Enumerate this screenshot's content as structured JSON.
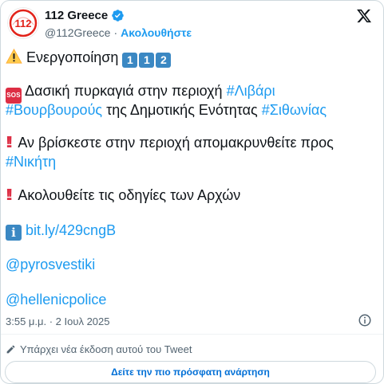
{
  "header": {
    "display_name": "112 Greece",
    "handle": "@112Greece",
    "separator": "·",
    "follow_label": "Ακολουθήστε",
    "avatar_text": "112"
  },
  "tweet": {
    "line1_text": "Ενεργοποίηση",
    "keycaps": [
      "1",
      "1",
      "2"
    ],
    "sos_badge": "SOS",
    "line2_text": "Δασική πυρκαγιά στην περιοχή",
    "line2_tag": "#Λιβάρι",
    "line3_tag1": "#Βουρβουρούς",
    "line3_text": "της Δημοτικής Ενότητας",
    "line3_tag2": "#Σιθωνίας",
    "line4_text": "Αν βρίσκεστε στην περιοχή απομακρυνθείτε προς",
    "line5_tag": "#Νικήτη",
    "line6_text": "Ακολουθείτε τις οδηγίες των Αρχών",
    "info_glyph": "i",
    "link": "bit.ly/429cngB",
    "mention1": "@pyrosvestiki",
    "mention2": "@hellenicpolice"
  },
  "meta": {
    "timestamp": "3:55 μ.μ. · 2 Ιουλ 2025",
    "edit_notice": "Υπάρχει νέα έκδοση αυτού του Tweet",
    "latest_button": "Δείτε την πιο πρόσφατη ανάρτηση"
  },
  "icons": [
    "verified-badge-icon",
    "x-logo-icon",
    "warning-icon",
    "keycap-icon",
    "sos-icon",
    "double-exclamation-icon",
    "info-box-icon",
    "info-circle-icon",
    "pencil-icon"
  ],
  "colors": {
    "link": "#1d9bf0",
    "text": "#0f1419",
    "muted": "#536471",
    "keycap": "#3b88c3",
    "alert_red": "#dd2e44",
    "avatar_red": "#e2231a"
  }
}
